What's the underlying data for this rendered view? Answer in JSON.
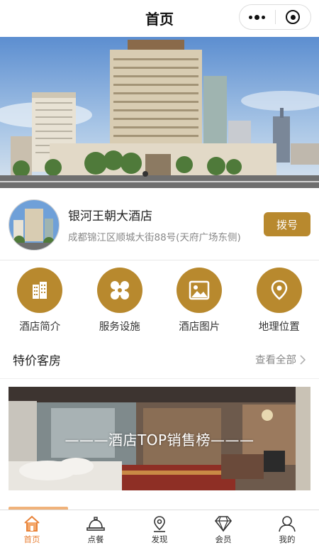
{
  "navbar": {
    "title": "首页"
  },
  "hotel": {
    "name": "银河王朝大酒店",
    "address": "成都锦江区顺城大街88号(天府广场东侧)",
    "call_label": "拨号"
  },
  "menu": [
    {
      "label": "酒店简介",
      "icon": "building-icon"
    },
    {
      "label": "服务设施",
      "icon": "clover-icon"
    },
    {
      "label": "酒店图片",
      "icon": "picture-icon"
    },
    {
      "label": "地理位置",
      "icon": "location-pin-icon"
    }
  ],
  "section": {
    "title": "特价客房",
    "view_all": "查看全部"
  },
  "room_card": {
    "caption": "———酒店TOP销售榜———"
  },
  "tabbar": [
    {
      "label": "首页",
      "icon": "home-icon",
      "active": true
    },
    {
      "label": "点餐",
      "icon": "dining-bell-icon",
      "active": false
    },
    {
      "label": "发现",
      "icon": "map-pin-icon",
      "active": false
    },
    {
      "label": "会员",
      "icon": "diamond-icon",
      "active": false
    },
    {
      "label": "我的",
      "icon": "user-icon",
      "active": false
    }
  ],
  "colors": {
    "accent": "#b8892e",
    "tab_active": "#e8833a"
  }
}
